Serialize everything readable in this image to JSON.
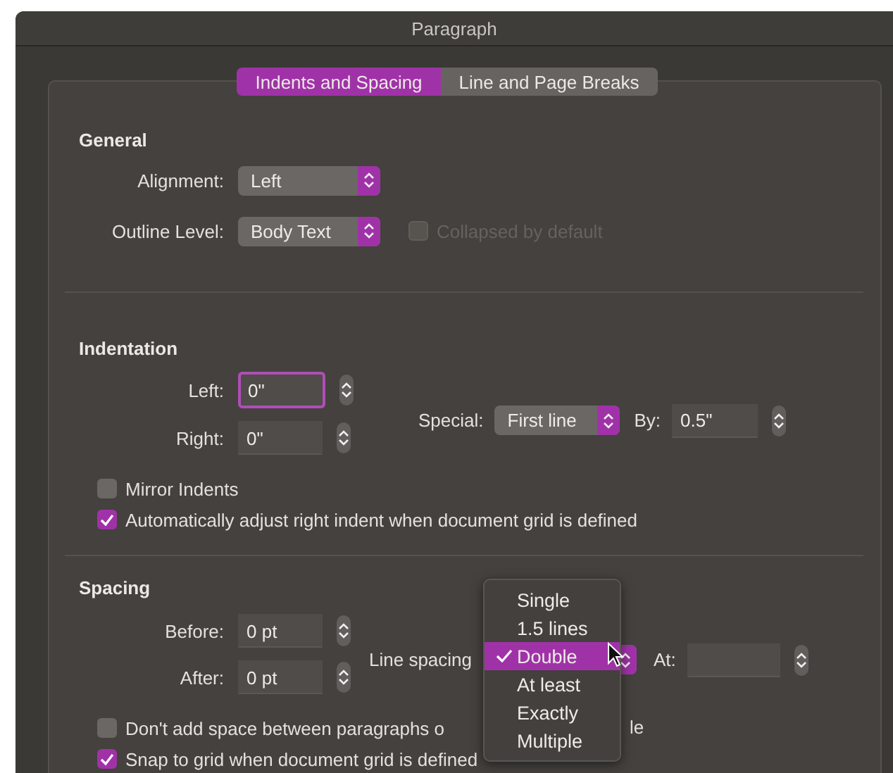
{
  "window": {
    "title": "Paragraph"
  },
  "tabs": [
    {
      "label": "Indents and Spacing",
      "selected": true
    },
    {
      "label": "Line and Page Breaks",
      "selected": false
    }
  ],
  "general": {
    "heading": "General",
    "alignment": {
      "label": "Alignment:",
      "value": "Left"
    },
    "outline_level": {
      "label": "Outline Level:",
      "value": "Body Text"
    },
    "collapsed": {
      "label": "Collapsed by default",
      "checked": false,
      "disabled": true
    }
  },
  "indentation": {
    "heading": "Indentation",
    "left": {
      "label": "Left:",
      "value": "0\"",
      "focused": true
    },
    "right": {
      "label": "Right:",
      "value": "0\"",
      "focused": false
    },
    "special": {
      "label": "Special:",
      "value": "First line"
    },
    "by": {
      "label": "By:",
      "value": "0.5\""
    },
    "checkboxes": [
      {
        "label": "Mirror Indents",
        "checked": false
      },
      {
        "label": "Automatically adjust right indent when document grid is defined",
        "checked": true
      }
    ]
  },
  "spacing": {
    "heading": "Spacing",
    "before": {
      "label": "Before:",
      "value": "0 pt"
    },
    "after": {
      "label": "After:",
      "value": "0 pt"
    },
    "line_spacing": {
      "label": "Line spacing"
    },
    "at": {
      "label": "At:"
    },
    "menu": [
      {
        "label": "Single",
        "selected": false
      },
      {
        "label": "1.5 lines",
        "selected": false
      },
      {
        "label": "Double",
        "selected": true
      },
      {
        "label": "At least",
        "selected": false
      },
      {
        "label": "Exactly",
        "selected": false
      },
      {
        "label": "Multiple",
        "selected": false
      }
    ],
    "checkboxes": [
      {
        "label": "Don't add space between paragraphs o",
        "tail": "le",
        "checked": false
      },
      {
        "label": "Snap to grid when document grid is defined",
        "checked": true
      }
    ]
  }
}
